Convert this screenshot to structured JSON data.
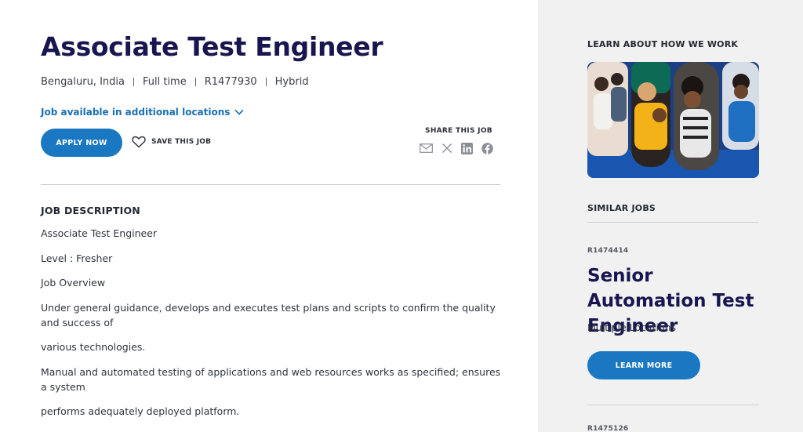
{
  "job": {
    "title": "Associate Test Engineer",
    "location": "Bengaluru, India",
    "type": "Full time",
    "req_id": "R1477930",
    "mode": "Hybrid",
    "more_locations": "Job available in additional locations",
    "apply_label": "APPLY NOW",
    "save_label": "SAVE THIS JOB",
    "share_label": "SHARE THIS JOB",
    "share_icons": [
      "email-icon",
      "x-icon",
      "linkedin-icon",
      "facebook-icon"
    ]
  },
  "description": {
    "heading": "JOB DESCRIPTION",
    "paragraphs": [
      "Associate Test Engineer",
      "Level : Fresher",
      "Job Overview",
      "Under general guidance, develops and executes test plans and scripts to confirm the quality and success of",
      "various technologies.",
      "Manual and automated testing of applications and web resources works as specified; ensures a system",
      "performs adequately deployed platform."
    ]
  },
  "sidebar": {
    "how_we_work": "LEARN ABOUT HOW WE WORK",
    "similar_heading": "SIMILAR JOBS",
    "similar_jobs": [
      {
        "req": "R1474414",
        "title": "Senior Automation Test Engineer",
        "location": "Multiple Locations",
        "button": "LEARN MORE"
      },
      {
        "req": "R1475126"
      }
    ]
  },
  "colors": {
    "title": "#18164f",
    "accent": "#1a78c2",
    "link": "#1a6fb3",
    "sidebar_bg": "#f1f1f1"
  }
}
